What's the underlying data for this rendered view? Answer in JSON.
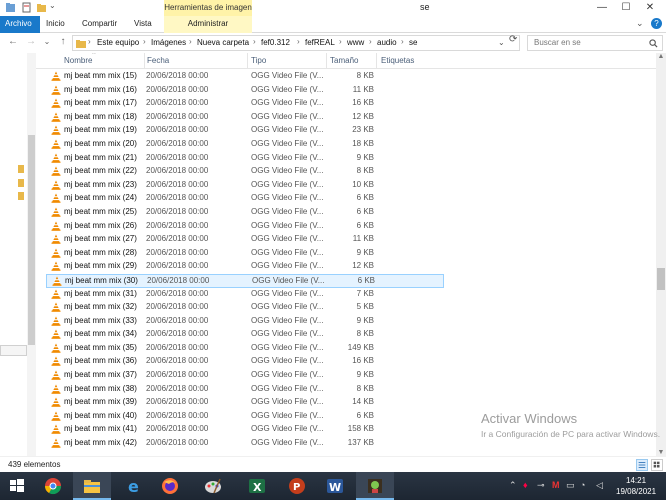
{
  "window": {
    "title": "se",
    "contextual_tab_group": "Herramientas de imagen",
    "minimize": "—",
    "maximize": "☐",
    "close": "✕"
  },
  "ribbon": {
    "tabs": [
      "Archivo",
      "Inicio",
      "Compartir",
      "Vista",
      "Administrar"
    ],
    "collapse_glyph": "⌄",
    "help_glyph": "?"
  },
  "address": {
    "back": "←",
    "forward": "→",
    "recent": "⌄",
    "up": "↑",
    "breadcrumbs": [
      "Este equipo",
      "Imágenes",
      "Nueva carpeta",
      "fef0.312",
      "fefREAL",
      "www",
      "audio",
      "se"
    ],
    "separator": "›",
    "refresh": "⟳",
    "search_placeholder": "Buscar en se",
    "search_icon": "search-icon"
  },
  "columns": [
    "Nombre",
    "Fecha",
    "Tipo",
    "Tamaño",
    "Etiquetas"
  ],
  "files": [
    {
      "name": "mj beat mm mix (15)",
      "date": "20/06/2018 00:00",
      "type": "OGG Video File (V...",
      "size": "8 KB"
    },
    {
      "name": "mj beat mm mix (16)",
      "date": "20/06/2018 00:00",
      "type": "OGG Video File (V...",
      "size": "11 KB"
    },
    {
      "name": "mj beat mm mix (17)",
      "date": "20/06/2018 00:00",
      "type": "OGG Video File (V...",
      "size": "16 KB"
    },
    {
      "name": "mj beat mm mix (18)",
      "date": "20/06/2018 00:00",
      "type": "OGG Video File (V...",
      "size": "12 KB"
    },
    {
      "name": "mj beat mm mix (19)",
      "date": "20/06/2018 00:00",
      "type": "OGG Video File (V...",
      "size": "23 KB"
    },
    {
      "name": "mj beat mm mix (20)",
      "date": "20/06/2018 00:00",
      "type": "OGG Video File (V...",
      "size": "18 KB"
    },
    {
      "name": "mj beat mm mix (21)",
      "date": "20/06/2018 00:00",
      "type": "OGG Video File (V...",
      "size": "9 KB"
    },
    {
      "name": "mj beat mm mix (22)",
      "date": "20/06/2018 00:00",
      "type": "OGG Video File (V...",
      "size": "8 KB"
    },
    {
      "name": "mj beat mm mix (23)",
      "date": "20/06/2018 00:00",
      "type": "OGG Video File (V...",
      "size": "10 KB"
    },
    {
      "name": "mj beat mm mix (24)",
      "date": "20/06/2018 00:00",
      "type": "OGG Video File (V...",
      "size": "6 KB"
    },
    {
      "name": "mj beat mm mix (25)",
      "date": "20/06/2018 00:00",
      "type": "OGG Video File (V...",
      "size": "6 KB"
    },
    {
      "name": "mj beat mm mix (26)",
      "date": "20/06/2018 00:00",
      "type": "OGG Video File (V...",
      "size": "6 KB"
    },
    {
      "name": "mj beat mm mix (27)",
      "date": "20/06/2018 00:00",
      "type": "OGG Video File (V...",
      "size": "11 KB"
    },
    {
      "name": "mj beat mm mix (28)",
      "date": "20/06/2018 00:00",
      "type": "OGG Video File (V...",
      "size": "9 KB"
    },
    {
      "name": "mj beat mm mix (29)",
      "date": "20/06/2018 00:00",
      "type": "OGG Video File (V...",
      "size": "12 KB"
    },
    {
      "name": "mj beat mm mix (30)",
      "date": "20/06/2018 00:00",
      "type": "OGG Video File (V...",
      "size": "6 KB",
      "selected": true
    },
    {
      "name": "mj beat mm mix (31)",
      "date": "20/06/2018 00:00",
      "type": "OGG Video File (V...",
      "size": "7 KB"
    },
    {
      "name": "mj beat mm mix (32)",
      "date": "20/06/2018 00:00",
      "type": "OGG Video File (V...",
      "size": "5 KB"
    },
    {
      "name": "mj beat mm mix (33)",
      "date": "20/06/2018 00:00",
      "type": "OGG Video File (V...",
      "size": "9 KB"
    },
    {
      "name": "mj beat mm mix (34)",
      "date": "20/06/2018 00:00",
      "type": "OGG Video File (V...",
      "size": "8 KB"
    },
    {
      "name": "mj beat mm mix (35)",
      "date": "20/06/2018 00:00",
      "type": "OGG Video File (V...",
      "size": "149 KB"
    },
    {
      "name": "mj beat mm mix (36)",
      "date": "20/06/2018 00:00",
      "type": "OGG Video File (V...",
      "size": "16 KB"
    },
    {
      "name": "mj beat mm mix (37)",
      "date": "20/06/2018 00:00",
      "type": "OGG Video File (V...",
      "size": "9 KB"
    },
    {
      "name": "mj beat mm mix (38)",
      "date": "20/06/2018 00:00",
      "type": "OGG Video File (V...",
      "size": "8 KB"
    },
    {
      "name": "mj beat mm mix (39)",
      "date": "20/06/2018 00:00",
      "type": "OGG Video File (V...",
      "size": "14 KB"
    },
    {
      "name": "mj beat mm mix (40)",
      "date": "20/06/2018 00:00",
      "type": "OGG Video File (V...",
      "size": "6 KB"
    },
    {
      "name": "mj beat mm mix (41)",
      "date": "20/06/2018 00:00",
      "type": "OGG Video File (V...",
      "size": "158 KB"
    },
    {
      "name": "mj beat mm mix (42)",
      "date": "20/06/2018 00:00",
      "type": "OGG Video File (V...",
      "size": "137 KB"
    }
  ],
  "status": {
    "count": "439 elementos"
  },
  "watermark": {
    "title": "Activar Windows",
    "text": "Ir a Configuración de PC para activar Windows."
  },
  "taskbar": {
    "apps": [
      "windows-start",
      "chrome",
      "file-explorer",
      "edge",
      "firefox",
      "paint",
      "excel",
      "powerpoint",
      "word",
      "game-app"
    ],
    "active_app": "file-explorer",
    "tray_glyphs": [
      "⌃",
      "🔊",
      "M",
      "🔋",
      "🌐",
      "🖨"
    ],
    "time": "14:21",
    "date": "19/08/2021"
  },
  "colors": {
    "file_tab": "#1979ca",
    "context_tab": "#fff3a8",
    "selection_bg": "#e5f3ff",
    "selection_border": "#99d1ff",
    "vlc_orange": "#f08a00"
  }
}
